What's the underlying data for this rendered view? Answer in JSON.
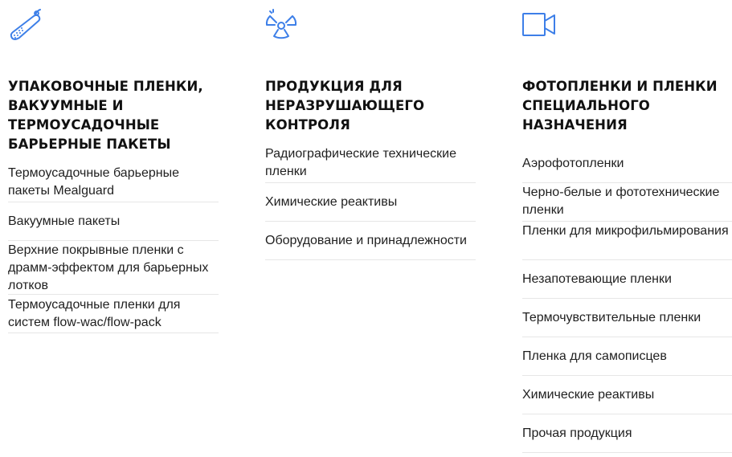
{
  "accent_color": "#3d7fe8",
  "columns": [
    {
      "icon": "sausage-icon",
      "title": "УПАКОВОЧНЫЕ ПЛЕНКИ, ВАКУУМНЫЕ И ТЕРМОУСАДОЧНЫЕ БАРЬЕРНЫЕ ПАКЕТЫ",
      "items": [
        "Термоусадочные барьерные пакеты Mealguard",
        "Вакуумные пакеты",
        "Верхние покрывные пленки с драмм-эффектом для барьерных лотков",
        "Термоусадочные пленки для систем flow-wac/flow-pack"
      ]
    },
    {
      "icon": "radiation-icon",
      "title": "ПРОДУКЦИЯ ДЛЯ НЕРАЗРУШАЮЩЕГО КОНТРОЛЯ",
      "items": [
        "Радиографические технические пленки",
        "Химические реактивы",
        "Оборудование и принадлежности"
      ]
    },
    {
      "icon": "video-camera-icon",
      "title": "ФОТОПЛЕНКИ И ПЛЕНКИ СПЕЦИАЛЬНОГО НАЗНАЧЕНИЯ",
      "items": [
        "Аэрофотопленки",
        "Черно-белые и фототехнические пленки",
        "Пленки для микрофильмирования",
        "Незапотевающие пленки",
        "Термочувствительные пленки",
        "Пленка для самописцев",
        "Химические реактивы",
        "Прочая продукция"
      ]
    }
  ]
}
